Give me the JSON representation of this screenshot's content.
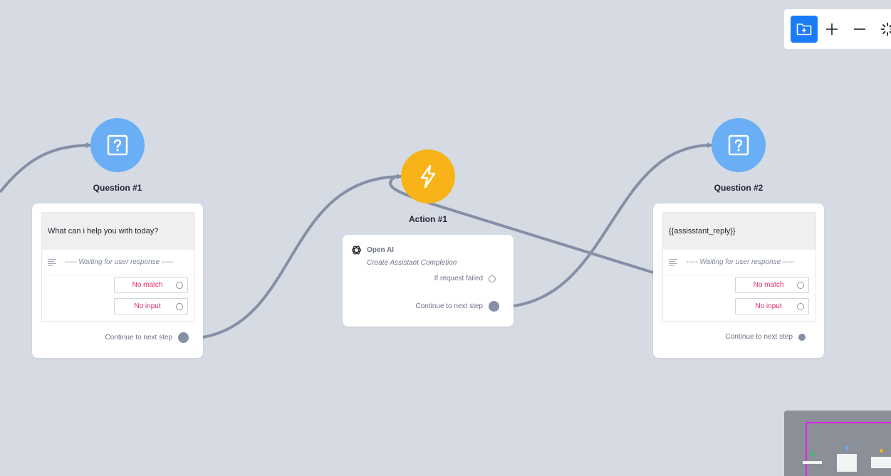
{
  "question1": {
    "title": "Question #1",
    "prompt": "What can i help you with today?",
    "waiting": "----- Waiting for user response -----",
    "no_match": "No match",
    "no_input": "No input",
    "continue": "Continue to next step"
  },
  "action1": {
    "title": "Action #1",
    "provider": "Open AI",
    "operation": "Create Assistant Completion",
    "failed": "If request failed",
    "continue": "Continue to next step"
  },
  "question2": {
    "title": "Question #2",
    "prompt": "{{assisstant_reply}}",
    "waiting": "----- Waiting for user response -----",
    "no_match": "No match",
    "no_input": "No input",
    "continue": "Continue to next step"
  },
  "toolbar": {
    "icons": [
      "add-folder-icon",
      "zoom-in-icon",
      "zoom-out-icon",
      "loading-spinner-icon"
    ]
  },
  "colors": {
    "canvas": "#d6dbe3",
    "question": "#6aaef5",
    "action": "#f7b318",
    "edge": "#8590a6",
    "error_label": "#e0296b",
    "primary": "#1a7cf5",
    "minimap_frame": "#e025e6"
  }
}
